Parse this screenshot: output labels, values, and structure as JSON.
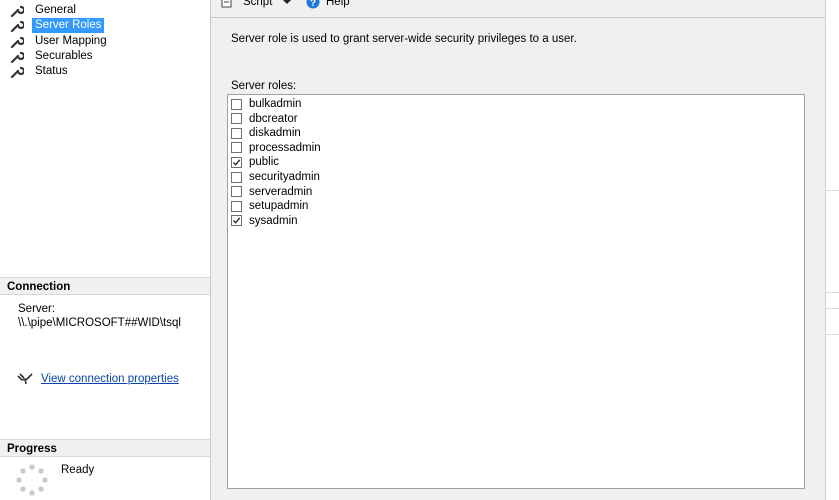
{
  "pages": [
    {
      "label": "General",
      "selected": false
    },
    {
      "label": "Server Roles",
      "selected": true
    },
    {
      "label": "User Mapping",
      "selected": false
    },
    {
      "label": "Securables",
      "selected": false
    },
    {
      "label": "Status",
      "selected": false
    }
  ],
  "connection": {
    "header": "Connection",
    "server_label": "Server:",
    "server_value": "\\\\.\\pipe\\MICROSOFT##WID\\tsql",
    "link_text": "View connection properties"
  },
  "progress": {
    "header": "Progress",
    "status": "Ready"
  },
  "toolbar": {
    "script_label": "Script",
    "help_label": "Help"
  },
  "description": "Server role is used to grant server-wide security privileges to a user.",
  "roles_label": "Server roles:",
  "roles": [
    {
      "name": "bulkadmin",
      "checked": false
    },
    {
      "name": "dbcreator",
      "checked": false
    },
    {
      "name": "diskadmin",
      "checked": false
    },
    {
      "name": "processadmin",
      "checked": false
    },
    {
      "name": "public",
      "checked": true
    },
    {
      "name": "securityadmin",
      "checked": false
    },
    {
      "name": "serveradmin",
      "checked": false
    },
    {
      "name": "setupadmin",
      "checked": false
    },
    {
      "name": "sysadmin",
      "checked": true
    }
  ],
  "colors": {
    "selection": "#3399ff",
    "panel": "#f0f0f0",
    "link": "#0645ad"
  }
}
